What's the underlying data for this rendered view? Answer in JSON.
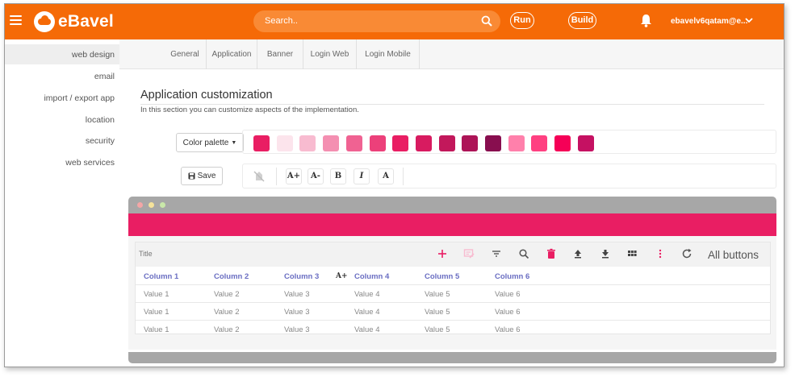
{
  "app": {
    "name": "eBavel"
  },
  "topbar": {
    "search_placeholder": "Search..",
    "run_label": "Run",
    "build_label": "Build",
    "user": "ebavelv6qatam@e..."
  },
  "sidebar": {
    "items": [
      {
        "label": "web design"
      },
      {
        "label": "email"
      },
      {
        "label": "import / export app"
      },
      {
        "label": "location"
      },
      {
        "label": "security"
      },
      {
        "label": "web services"
      }
    ]
  },
  "tabs": [
    {
      "label": "General"
    },
    {
      "label": "Application"
    },
    {
      "label": "Banner"
    },
    {
      "label": "Login Web"
    },
    {
      "label": "Login Mobile"
    }
  ],
  "main": {
    "title": "Application customization",
    "subtitle": "In this section you can customize aspects of the implementation."
  },
  "palette": {
    "button_label": "Color palette",
    "swatches": [
      "#e91e63",
      "#fce4ec",
      "#f8bbd0",
      "#f48fb1",
      "#f06292",
      "#ec407a",
      "#e91e63",
      "#d81b60",
      "#c2185b",
      "#ad1457",
      "#880e4f",
      "#ff80ab",
      "#ff4081",
      "#f50057",
      "#c51162"
    ]
  },
  "format_toolbar": {
    "save_label": "Save",
    "buttons": [
      "A+",
      "A-",
      "B",
      "I",
      "A"
    ]
  },
  "preview": {
    "header_color": "#e91e63",
    "table_title": "Title",
    "all_buttons_label": "All buttons",
    "font_hint": "A+",
    "columns": [
      "Column 1",
      "Column 2",
      "Column 3",
      "Column 4",
      "Column 5",
      "Column 6"
    ],
    "rows": [
      [
        "Value 1",
        "Value 2",
        "Value 3",
        "Value 4",
        "Value 5",
        "Value 6"
      ],
      [
        "Value 1",
        "Value 2",
        "Value 3",
        "Value 4",
        "Value 5",
        "Value 6"
      ],
      [
        "Value 1",
        "Value 2",
        "Value 3",
        "Value 4",
        "Value 5",
        "Value 6"
      ]
    ],
    "icons": [
      "add-icon",
      "edit-list-icon",
      "filter-icon",
      "search-icon",
      "delete-icon",
      "upload-icon",
      "download-icon",
      "grid-icon",
      "more-vertical-icon",
      "refresh-icon"
    ]
  }
}
